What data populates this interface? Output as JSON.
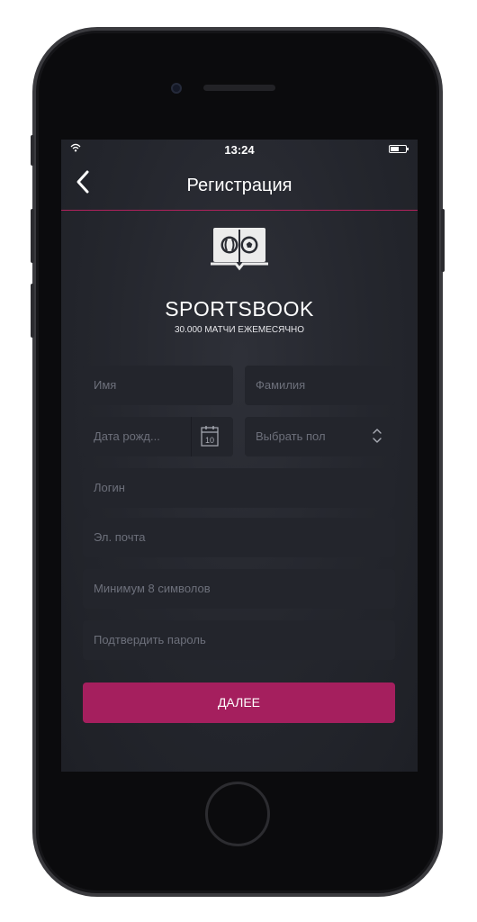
{
  "status_bar": {
    "time": "13:24"
  },
  "nav": {
    "title": "Регистрация"
  },
  "brand": {
    "name": "SPORTSBOOK",
    "tagline": "30.000 МАТЧИ ЕЖЕМЕСЯЧНО"
  },
  "form": {
    "first_name_placeholder": "Имя",
    "last_name_placeholder": "Фамилия",
    "birthdate_placeholder": "Дата рожд...",
    "calendar_day": "10",
    "gender_placeholder": "Выбрать пол",
    "login_placeholder": "Логин",
    "email_placeholder": "Эл. почта",
    "password_placeholder": "Минимум 8 символов",
    "confirm_password_placeholder": "Подтвердить пароль",
    "submit_label": "ДАЛЕЕ"
  },
  "colors": {
    "accent": "#a51f5e",
    "background": "#24262d",
    "field": "#23252c",
    "placeholder": "#6d707b"
  },
  "icons": [
    "wifi-icon",
    "battery-icon",
    "back-chevron-icon",
    "sportsbook-logo-icon",
    "calendar-icon",
    "updown-chevron-icon"
  ]
}
